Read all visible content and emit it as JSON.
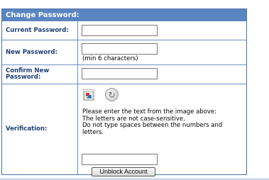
{
  "form": {
    "title": "Change Password:",
    "current_password": {
      "label": "Current Password:",
      "value": ""
    },
    "new_password": {
      "label": "New Password:",
      "value": "",
      "hint": "(min 6 characters)"
    },
    "confirm_password": {
      "label_line1": "Confirm New",
      "label_line2": "Password:",
      "value": ""
    },
    "verification": {
      "label": "Verification:",
      "instructions": [
        "Please enter the text from the image above:",
        "The letters are not case-sensitive.",
        "Do not type spaces between the numbers and",
        "letters."
      ],
      "value": "",
      "refresh_icon": "refresh-icon",
      "captcha_icon": "captcha-image-icon"
    },
    "submit_label": "Unblock Account"
  },
  "colors": {
    "header_bg": "#5b85c0",
    "label_text": "#1f3e75",
    "border": "#4a6fa5"
  }
}
